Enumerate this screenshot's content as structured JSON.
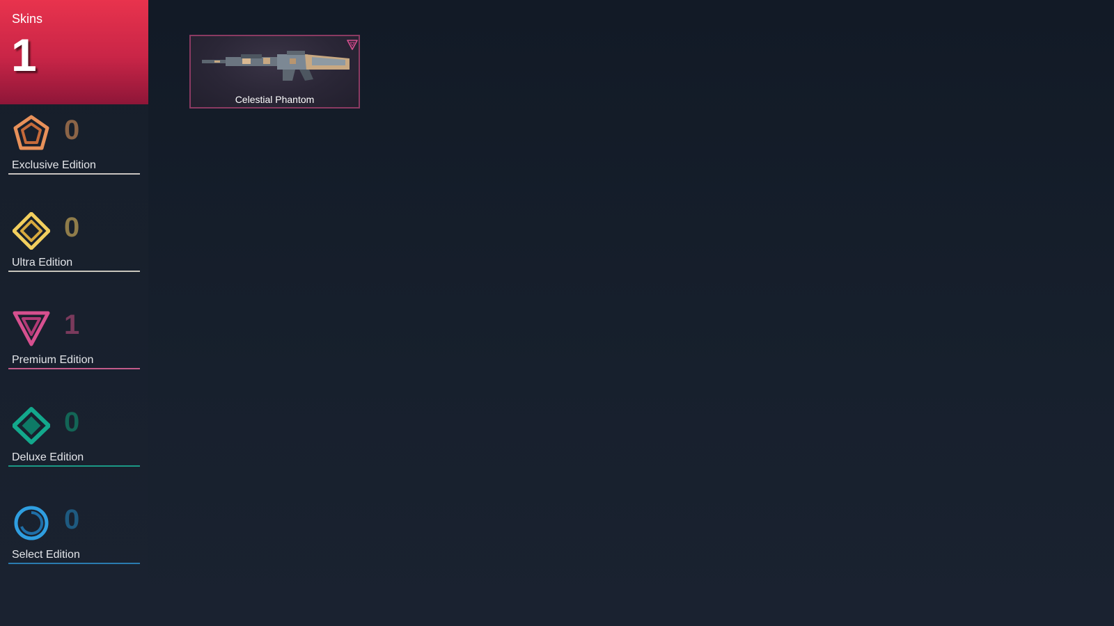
{
  "header": {
    "title": "Skins",
    "count": "1"
  },
  "tiers": [
    {
      "label": "Exclusive Edition",
      "count": "0",
      "icon": "exclusive-pentagon-icon",
      "color": "#e8915a",
      "count_color": "#8b6447",
      "line_color": "#c9c3c0"
    },
    {
      "label": "Ultra Edition",
      "count": "0",
      "icon": "ultra-diamond-icon",
      "color": "#f2cf5e",
      "count_color": "#8f7c4a",
      "line_color": "#c9c7bd"
    },
    {
      "label": "Premium Edition",
      "count": "1",
      "icon": "premium-triangle-icon",
      "color": "#d6508f",
      "count_color": "#7a3a5c",
      "line_color": "#c25b8a"
    },
    {
      "label": "Deluxe Edition",
      "count": "0",
      "icon": "deluxe-rhombus-icon",
      "color": "#13a88c",
      "count_color": "#136556",
      "line_color": "#1b9a86"
    },
    {
      "label": "Select Edition",
      "count": "0",
      "icon": "select-circle-icon",
      "color": "#2f9ee0",
      "count_color": "#1e5a80",
      "line_color": "#2a7cb0"
    }
  ],
  "skin_card": {
    "name": "Celestial Phantom",
    "tier_icon": "premium-triangle-icon",
    "border_color": "#8a3a62"
  }
}
